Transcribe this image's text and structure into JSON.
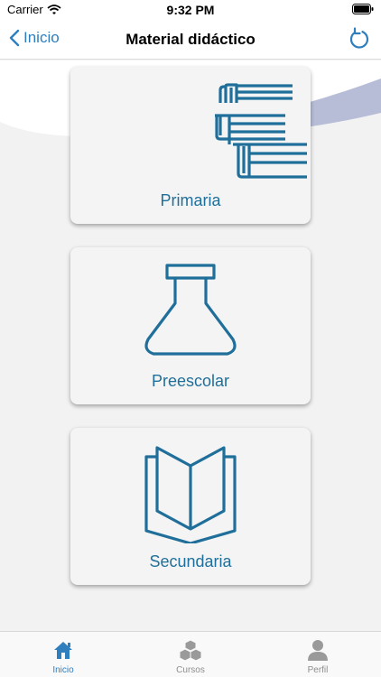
{
  "status_bar": {
    "carrier": "Carrier",
    "time": "9:32 PM"
  },
  "nav": {
    "back_label": "Inicio",
    "title": "Material didáctico"
  },
  "cards": [
    {
      "label": "Primaria",
      "icon": "books-icon"
    },
    {
      "label": "Preescolar",
      "icon": "flask-icon"
    },
    {
      "label": "Secundaria",
      "icon": "open-book-icon"
    }
  ],
  "tabs": [
    {
      "label": "Inicio",
      "icon": "home-icon",
      "active": true
    },
    {
      "label": "Cursos",
      "icon": "cubes-icon",
      "active": false
    },
    {
      "label": "Perfil",
      "icon": "person-icon",
      "active": false
    }
  ],
  "colors": {
    "accent": "#2f7fbf",
    "icon": "#1f6f9a",
    "inactive": "#8e8e8e",
    "swoosh": "#b7bdd6"
  }
}
